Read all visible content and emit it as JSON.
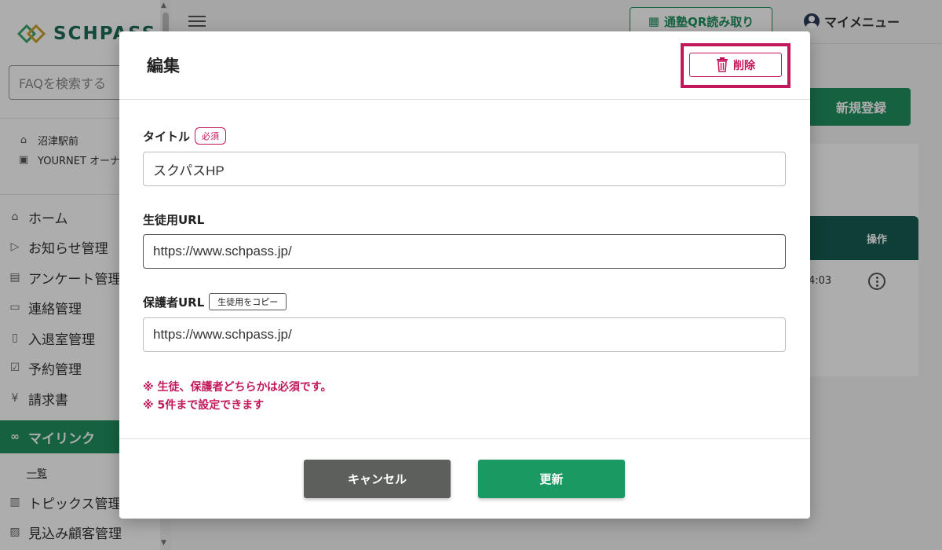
{
  "app": {
    "logo_text": "SCHPASS",
    "faq_search_placeholder": "FAQを検索する",
    "store_name": "沼津駅前",
    "owner_name": "YOURNET オーナー",
    "top_bar": {
      "qr_button_label": "通塾QR読み取り",
      "my_menu_label": "マイメニュー"
    },
    "nav": [
      {
        "label": "ホーム",
        "icon": "home-icon"
      },
      {
        "label": "お知らせ管理",
        "icon": "send-icon"
      },
      {
        "label": "アンケート管理",
        "icon": "survey-icon"
      },
      {
        "label": "連絡管理",
        "icon": "message-icon"
      },
      {
        "label": "入退室管理",
        "icon": "door-icon"
      },
      {
        "label": "予約管理",
        "icon": "calendar-icon"
      },
      {
        "label": "請求書",
        "icon": "yen-icon"
      },
      {
        "label": "マイリンク",
        "icon": "link-icon",
        "active": true
      },
      {
        "label": "トピックス管理",
        "icon": "topics-icon"
      },
      {
        "label": "見込み顧客管理",
        "icon": "prospect-icon"
      }
    ],
    "sub_nav_label": "一覧",
    "new_register_label": "新規登録",
    "table_header_action": "操作",
    "row_time": "4:03"
  },
  "modal": {
    "title": "編集",
    "delete_label": "削除",
    "fields": {
      "title": {
        "label": "タイトル",
        "badge": "必須",
        "value": "スクパスHP"
      },
      "student_url": {
        "label": "生徒用URL",
        "value": "https://www.schpass.jp/"
      },
      "guardian_url": {
        "label": "保護者URL",
        "copy_label": "生徒用をコピー",
        "value": "https://www.schpass.jp/"
      }
    },
    "notes": [
      "※ 生徒、保護者どちらかは必須です。",
      "※ 5件まで設定できます"
    ],
    "cancel_label": "キャンセル",
    "update_label": "更新"
  },
  "colors": {
    "brand_green": "#1f8f5f",
    "accent_magenta": "#c2185b",
    "cancel_gray": "#5c5f5c"
  }
}
